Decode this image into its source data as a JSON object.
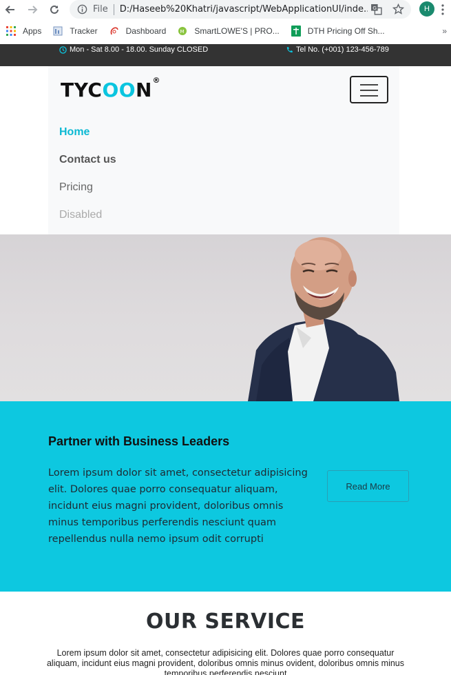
{
  "browser": {
    "scheme": "File",
    "url": "D:/Haseeb%20Khatri/javascript/WebApplicationUI/inde...",
    "profile_initial": "H",
    "bookmarks": [
      {
        "label": "Apps",
        "icon": "apps-grid-icon"
      },
      {
        "label": "Tracker",
        "icon": "tracker-icon"
      },
      {
        "label": "Dashboard",
        "icon": "dashboard-icon"
      },
      {
        "label": "SmartLOWE'S | PRO...",
        "icon": "smartlowes-icon"
      },
      {
        "label": "DTH Pricing Off Sh...",
        "icon": "sheets-icon"
      }
    ],
    "more": "»"
  },
  "topbar": {
    "hours": "Mon - Sat 8.00 - 18.00. Sunday CLOSED",
    "tel": "Tel No. (+001) 123-456-789",
    "icon_color": "#0bc5df"
  },
  "navbar": {
    "logo_part1": "TYC",
    "logo_part2": "OO",
    "logo_part3": "N",
    "logo_mark": "®",
    "links": {
      "home": "Home",
      "contact": "Contact us",
      "pricing": "Pricing",
      "disabled": "Disabled"
    }
  },
  "partner": {
    "title": "Partner with Business Leaders",
    "body": "Lorem ipsum dolor sit amet, consectetur adipisicing elit. Dolores quae porro consequatur aliquam, incidunt eius magni provident, doloribus omnis minus temporibus perferendis nesciunt quam repellendus nulla nemo ipsum odit corrupti",
    "button": "Read More",
    "background": "#0dc8e0"
  },
  "service": {
    "title": "OUR SERVICE",
    "body": "Lorem ipsum dolor sit amet, consectetur adipisicing elit. Dolores quae porro consequatur aliquam, incidunt eius magni provident, doloribus omnis minus ovident, doloribus omnis minus temporibus perferendis nesciunt"
  },
  "colors": {
    "accent": "#0bc5df",
    "topbar": "#333333",
    "navbar": "#f8f9fa"
  }
}
